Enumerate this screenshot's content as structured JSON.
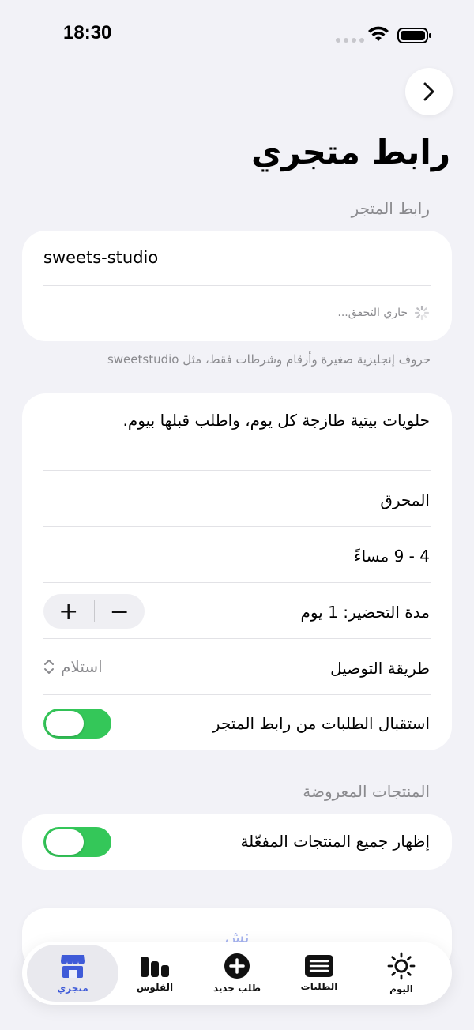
{
  "status_bar": {
    "time": "18:30"
  },
  "header": {
    "title": "رابط متجري"
  },
  "store_link": {
    "section_label": "رابط المتجر",
    "slug_value": "sweets-studio",
    "checking_text": "جاري التحقق...",
    "hint": "حروف إنجليزية صغيرة وأرقام وشرطات فقط، مثل sweetstudio"
  },
  "details": {
    "description": "حلويات بيتية طازجة كل يوم، واطلب قبلها بيوم.",
    "area": "المحرق",
    "hours": "4 - 9 مساءً",
    "prep_label": "مدة التحضير: 1 يوم",
    "stepper_plus": "+",
    "stepper_minus": "−",
    "delivery_label": "طريقة التوصيل",
    "delivery_value": "استلام",
    "accept_orders_label": "استقبال الطلبات من رابط المتجر",
    "accept_orders_on": true
  },
  "products": {
    "section_label": "المنتجات المعروضة",
    "show_all_label": "إظهار جميع المنتجات المفعّلة",
    "show_all_on": true
  },
  "publish": {
    "label": "نش"
  },
  "tabbar": {
    "items": [
      {
        "label": "متجري",
        "icon": "storefront-icon",
        "active": true
      },
      {
        "label": "الفلوس",
        "icon": "chart-bars-icon",
        "active": false
      },
      {
        "label": "طلب جديد",
        "icon": "plus-circle-icon",
        "active": false
      },
      {
        "label": "الطلبات",
        "icon": "list-icon",
        "active": false
      },
      {
        "label": "اليوم",
        "icon": "sun-icon",
        "active": false
      }
    ]
  },
  "colors": {
    "accent": "#3F5BD8",
    "toggle_on": "#34C759",
    "background": "#F2F2F7"
  }
}
